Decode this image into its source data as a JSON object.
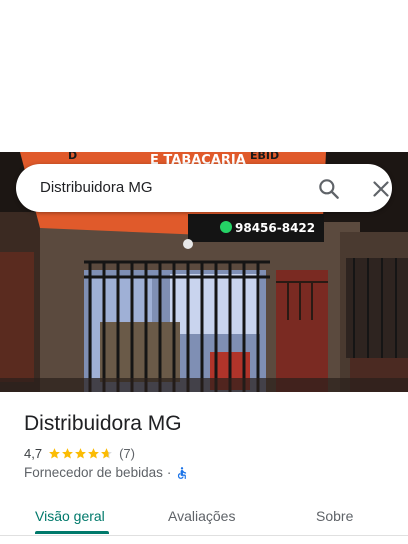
{
  "search": {
    "query": "Distribuidora MG"
  },
  "photo": {
    "sign_text_1": "E TABACARIA",
    "sign_phone": "98456-8422",
    "sign_partial_left": "D",
    "sign_partial_right": "EBID"
  },
  "place": {
    "name": "Distribuidora MG",
    "rating": "4,7",
    "review_count": "(7)",
    "stars_filled": 4.7,
    "category": "Fornecedor de bebidas",
    "separator": "·"
  },
  "tabs": [
    {
      "label": "Visão geral",
      "active": true
    },
    {
      "label": "Avaliações",
      "active": false
    },
    {
      "label": "Sobre",
      "active": false
    }
  ],
  "colors": {
    "accent": "#00796b",
    "star": "#fbbc04",
    "accessibility": "#1a73e8"
  }
}
